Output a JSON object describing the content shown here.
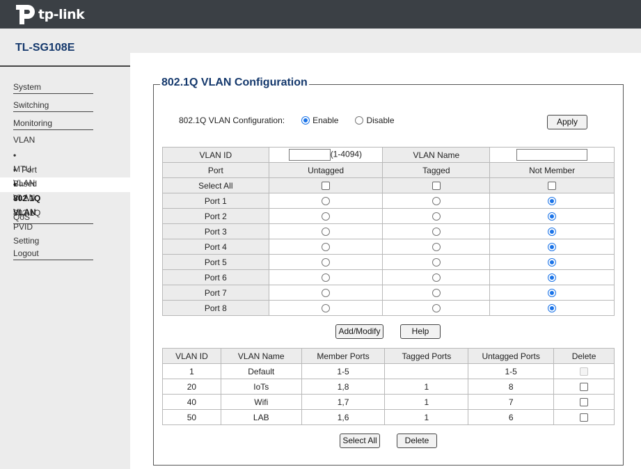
{
  "brand": {
    "logo_text": "tp-link",
    "logo_color": "#ffffff",
    "header_bg": "#3b4045"
  },
  "model": "TL-SG108E",
  "nav": {
    "system": "System",
    "switching": "Switching",
    "monitoring": "Monitoring",
    "vlan": "VLAN",
    "vlan_items": [
      "MTU VLAN",
      "Port Based VLAN",
      "802.1Q VLAN",
      "802.1Q PVID Setting"
    ],
    "active_item": "802.1Q VLAN",
    "qos": "QoS",
    "logout": "Logout"
  },
  "panel": {
    "title": "802.1Q VLAN Configuration",
    "config_label": "802.1Q VLAN Configuration:",
    "enable_label": "Enable",
    "disable_label": "Disable",
    "selected": "Enable",
    "apply": "Apply"
  },
  "form": {
    "vlan_id_label": "VLAN ID",
    "vlan_id_value": "",
    "vlan_id_range": "(1-4094)",
    "vlan_name_label": "VLAN Name",
    "vlan_name_value": "",
    "col_port": "Port",
    "col_untagged": "Untagged",
    "col_tagged": "Tagged",
    "col_not_member": "Not Member",
    "select_all": "Select All",
    "ports": [
      {
        "name": "Port 1",
        "selected": "Not Member"
      },
      {
        "name": "Port 2",
        "selected": "Not Member"
      },
      {
        "name": "Port 3",
        "selected": "Not Member"
      },
      {
        "name": "Port 4",
        "selected": "Not Member"
      },
      {
        "name": "Port 5",
        "selected": "Not Member"
      },
      {
        "name": "Port 6",
        "selected": "Not Member"
      },
      {
        "name": "Port 7",
        "selected": "Not Member"
      },
      {
        "name": "Port 8",
        "selected": "Not Member"
      }
    ],
    "add_modify": "Add/Modify",
    "help": "Help"
  },
  "vlan_table": {
    "headers": [
      "VLAN ID",
      "VLAN Name",
      "Member Ports",
      "Tagged Ports",
      "Untagged Ports",
      "Delete"
    ],
    "rows": [
      {
        "id": "1",
        "name": "Default",
        "members": "1-5",
        "tagged": "",
        "untagged": "1-5",
        "deletable": false
      },
      {
        "id": "20",
        "name": "IoTs",
        "members": "1,8",
        "tagged": "1",
        "untagged": "8",
        "deletable": true
      },
      {
        "id": "40",
        "name": "Wifi",
        "members": "1,7",
        "tagged": "1",
        "untagged": "7",
        "deletable": true
      },
      {
        "id": "50",
        "name": "LAB",
        "members": "1,6",
        "tagged": "1",
        "untagged": "6",
        "deletable": true
      }
    ],
    "select_all": "Select All",
    "delete": "Delete"
  },
  "colors": {
    "title": "#14386c",
    "sidebar_bg": "#ececec",
    "radio_on": "#1a73e8"
  }
}
